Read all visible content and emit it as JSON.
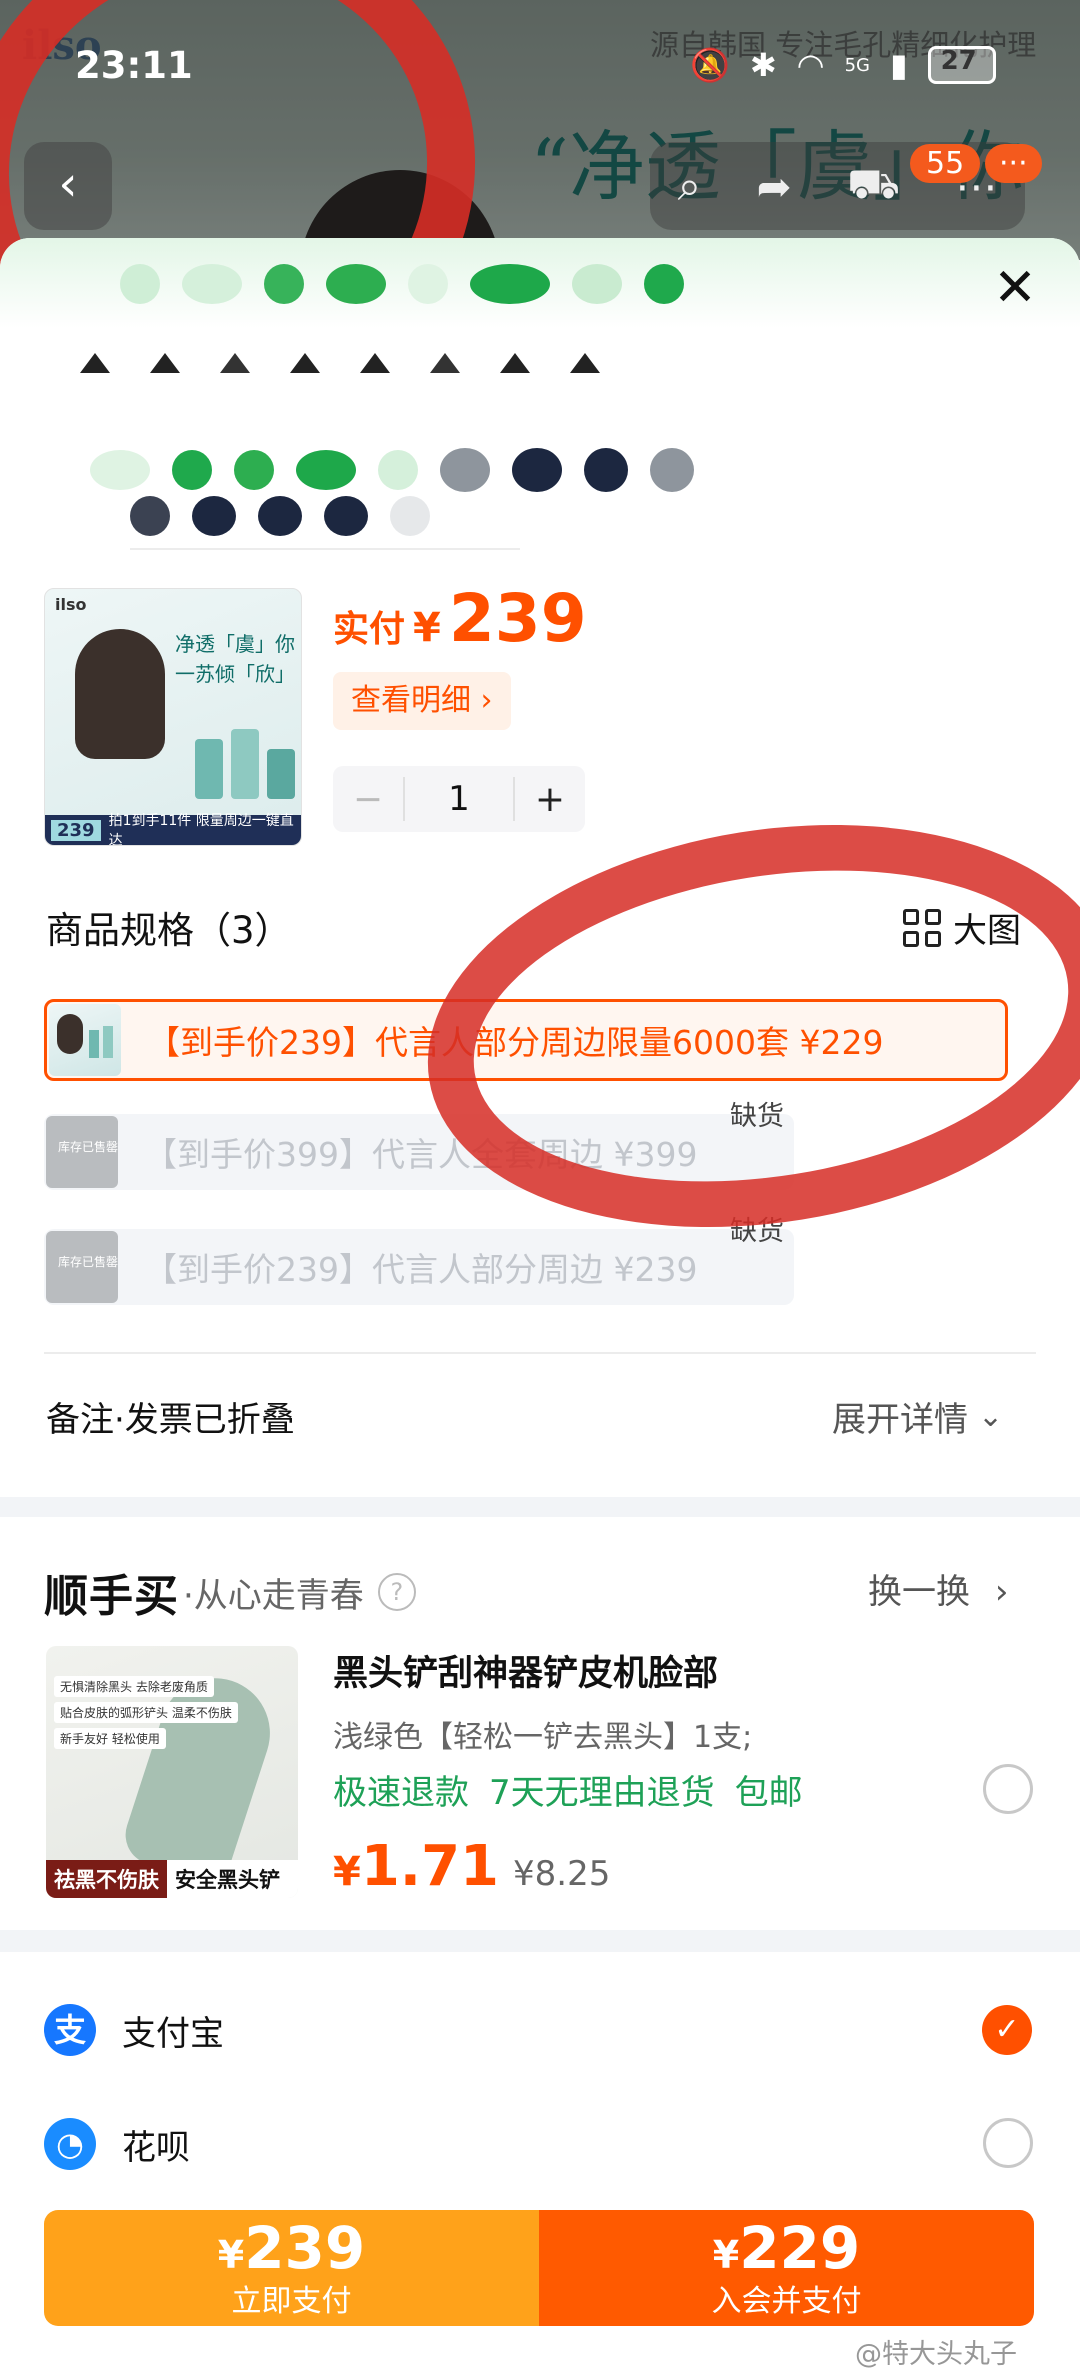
{
  "status_bar": {
    "time": "23:11",
    "network": "5G",
    "battery": "27"
  },
  "background_page": {
    "brand": "ilso",
    "slogan": "源自韩国 专注毛孔精细化护理",
    "hero_script": "“净透「虞」你",
    "cart_count": "55",
    "more_badge": "···"
  },
  "sheet": {
    "close_label": "✕",
    "paid_label": "实付",
    "currency": "¥",
    "paid_amount": "239",
    "detail_label": "查看明细 ›",
    "quantity": "1",
    "minus": "−",
    "plus": "+",
    "product_thumb": {
      "logo": "ilso",
      "script": "净透「虞」你 一苏倾「欣」",
      "price": "239",
      "promo": "拍1到手11件 限量周边一键直达"
    }
  },
  "spec": {
    "title": "商品规格（3）",
    "big_pic_label": "大图",
    "options": [
      {
        "text": "【到手价239】代言人部分周边限量6000套  ¥229",
        "state": "selected",
        "stock": ""
      },
      {
        "text": "【到手价399】代言人全套周边  ¥399",
        "state": "out_of_stock",
        "stock": "缺货"
      },
      {
        "text": "【到手价239】代言人部分周边  ¥239",
        "state": "out_of_stock",
        "stock": "缺货"
      }
    ],
    "sold_out_tag": "库存已售罄"
  },
  "remark": {
    "label": "备注·发票已折叠",
    "expand_label": "展开详情"
  },
  "shunshoumai": {
    "logo": "顺手买",
    "slogan": "·从心走青春",
    "swap_label": "换一换",
    "item": {
      "name": "黑头铲刮神器铲皮机脸部",
      "sku": "浅绿色【轻松一铲去黑头】1支;",
      "tags": [
        "极速退款",
        "7天无理由退货",
        "包邮"
      ],
      "price_symbol": "¥",
      "price": "1.71",
      "original_price": "¥8.25",
      "thumb_banner_left": "祛黑不伤肤",
      "thumb_banner_right": "安全黑头铲",
      "thumb_points": [
        "无惧清除黑头 去除老废角质",
        "贴合皮肤的弧形铲头 温柔不伤肤",
        "新手友好 轻松使用"
      ],
      "selected": false
    }
  },
  "payment": {
    "methods": [
      {
        "label": "支付宝",
        "icon": "alipay-icon",
        "glyph": "支",
        "selected": true
      },
      {
        "label": "花呗",
        "icon": "huabei-icon",
        "glyph": "◔",
        "selected": false
      }
    ]
  },
  "pay_buttons": {
    "now": {
      "symbol": "¥",
      "price": "239",
      "label": "立即支付"
    },
    "join": {
      "symbol": "¥",
      "price": "229",
      "label": "入会并支付"
    }
  },
  "watermark": "@特大头丸子",
  "colors": {
    "accent": "#ff5000",
    "pay_now": "#ffa21a",
    "pay_join": "#ff5a00",
    "green_tag": "#1ea157",
    "alipay_blue": "#1677ff"
  }
}
